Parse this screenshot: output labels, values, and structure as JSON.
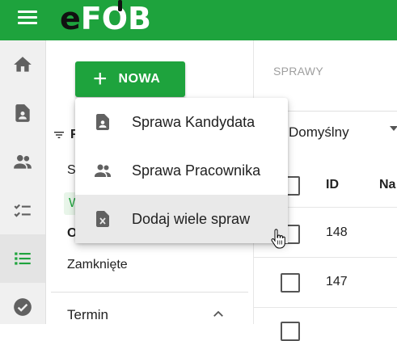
{
  "app": {
    "logo_e": "e",
    "logo_rest": "FOB"
  },
  "sidebar": {
    "items": [
      {
        "name": "home",
        "icon": "home-icon"
      },
      {
        "name": "document",
        "icon": "document-person-icon"
      },
      {
        "name": "people",
        "icon": "people-icon"
      },
      {
        "name": "checklist",
        "icon": "checklist-icon"
      },
      {
        "name": "list",
        "icon": "list-icon",
        "active": true
      },
      {
        "name": "check",
        "icon": "check-circle-icon"
      }
    ]
  },
  "new_button": {
    "label": "NOWA"
  },
  "filters": {
    "heading_initial": "F",
    "items": [
      "S",
      "W",
      "O",
      "Zamknięte"
    ],
    "termin_label": "Termin"
  },
  "main": {
    "title": "SPRAWY",
    "view_select": "Domyślny",
    "columns": {
      "id": "ID",
      "name_partial": "Na"
    },
    "rows": [
      {
        "id": "148"
      },
      {
        "id": "147"
      }
    ]
  },
  "dropdown_menu": {
    "items": [
      {
        "label": "Sprawa Kandydata",
        "icon": "candidate-document-icon"
      },
      {
        "label": "Sprawa Pracownika",
        "icon": "people-icon"
      },
      {
        "label": "Dodaj wiele spraw",
        "icon": "excel-file-icon",
        "hovered": true
      }
    ]
  },
  "colors": {
    "brand": "#1ea33d",
    "text": "#212121",
    "muted": "#9e9e9e"
  }
}
